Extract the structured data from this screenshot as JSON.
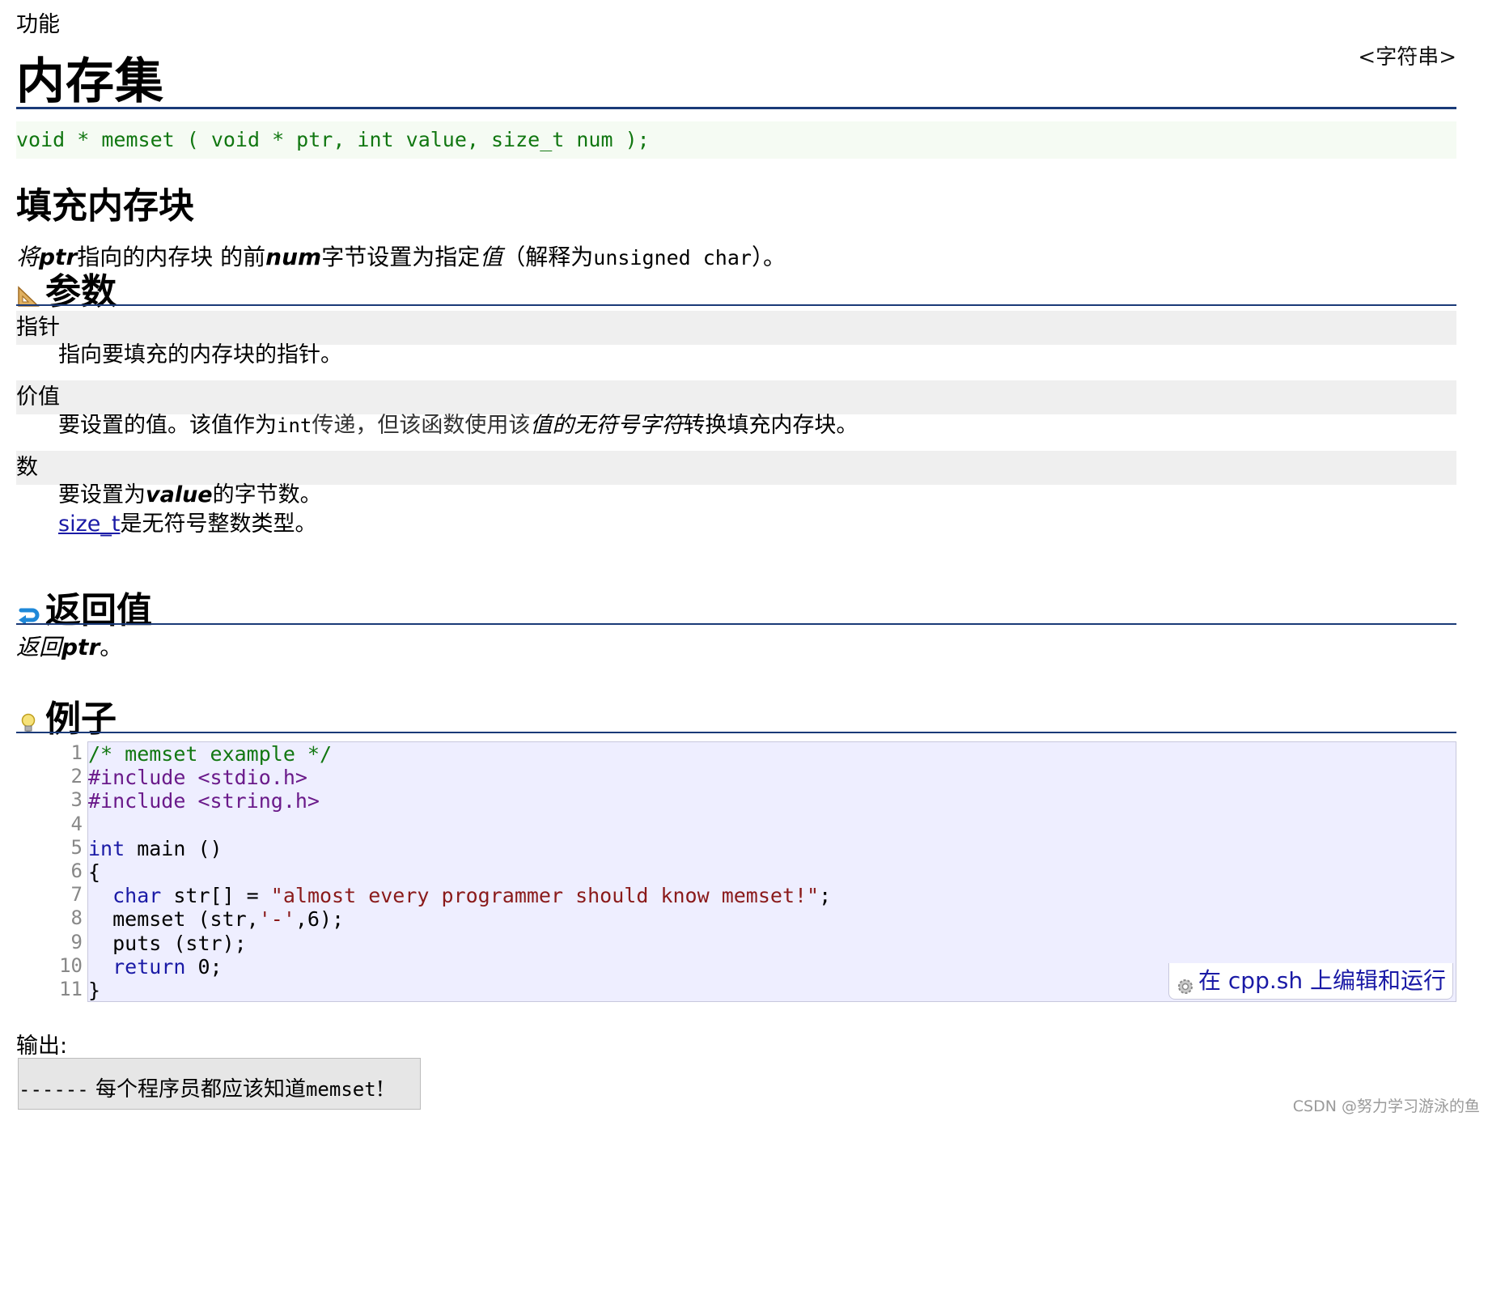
{
  "header": {
    "kind": "功能",
    "title": "内存集",
    "library_link": "<字符串>"
  },
  "prototype": "void * memset ( void * ptr, int value, size_t num );",
  "subtitle": "填充内存块",
  "description": {
    "p1": "将",
    "p2": "ptr",
    "p3": "指向的内存块 的前",
    "p4": "num",
    "p5": "字节设置为指定",
    "p6": "值",
    "p7": "（解释为",
    "p8": "unsigned char",
    "p9": "）。"
  },
  "parameters": {
    "heading": "参数",
    "items": [
      {
        "name": "指针",
        "desc": "指向要填充的内存块的指针。"
      },
      {
        "name": "价值",
        "d1": "要设置的值。该值作为",
        "d2": "int",
        "d3": "传递，但该函数使用该",
        "d4": "值的无符号字符",
        "d5": "转换填充内存块。"
      },
      {
        "name": "数",
        "d1": "要设置为",
        "d2": "value",
        "d3": "的字节数。",
        "link": "size_t",
        "d4": "是无符号整数类型。"
      }
    ]
  },
  "return_value": {
    "heading": "返回值",
    "t1": "返回",
    "t2": "ptr",
    "t3": "。"
  },
  "example": {
    "heading": "例子",
    "line_numbers": [
      "1",
      "2",
      "3",
      "4",
      "5",
      "6",
      "7",
      "8",
      "9",
      "10",
      "11"
    ],
    "code": {
      "l1": "/* memset example */",
      "l2": "#include <stdio.h>",
      "l3": "#include <string.h>",
      "l5_kw": "int",
      "l5_rest": " main ()",
      "l6": "{",
      "l7_kw": "char",
      "l7_mid": " str[] = ",
      "l7_str": "\"almost every programmer should know memset!\"",
      "l7_end": ";",
      "l8_pre": "  memset (str,",
      "l8_chr": "'-'",
      "l8_end": ",6);",
      "l9": "  puts (str);",
      "l10_kw": "return",
      "l10_rest": " 0;",
      "l11": "}"
    },
    "run_button": "在 cpp.sh 上编辑和运行"
  },
  "output": {
    "label": "输出:",
    "dashes": "------",
    "text": " 每个程序员都应该知道",
    "mono": "memset",
    "end": "!"
  },
  "watermark": "CSDN @努力学习游泳的鱼",
  "colors": {
    "rule": "#1a3a78",
    "code_bg": "#eeeeff",
    "proto_text": "#117711",
    "link": "#1a1aa6"
  }
}
